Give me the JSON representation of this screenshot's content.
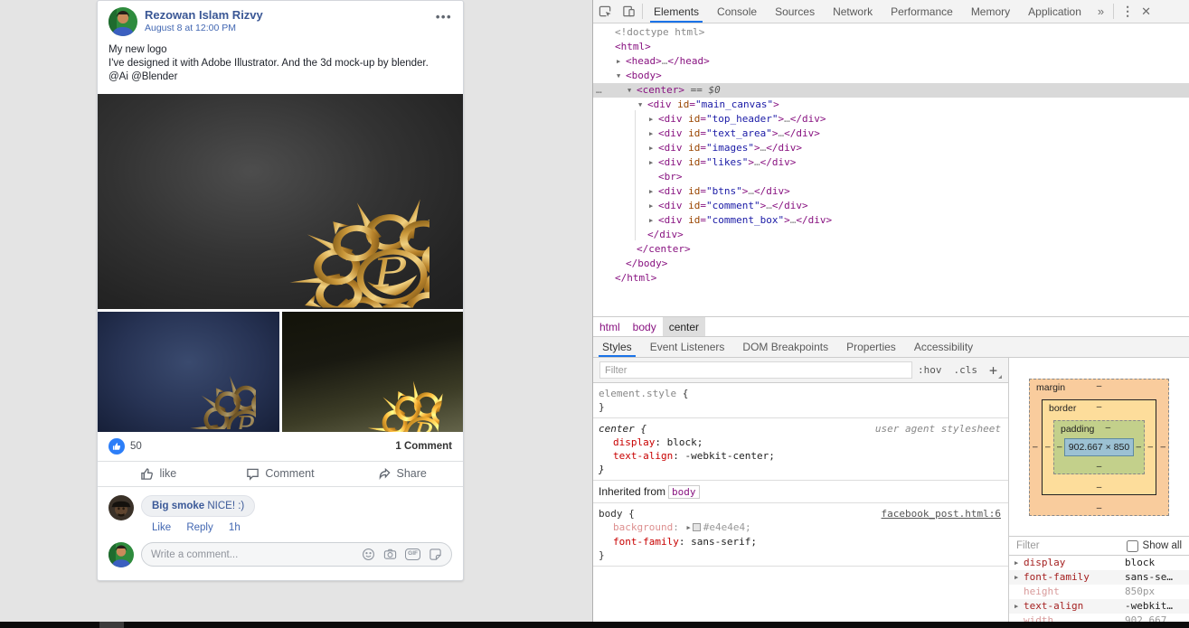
{
  "page": {
    "background": "#e4e4e4",
    "post": {
      "author": "Rezowan Islam Rizvy",
      "timestamp": "August 8 at 12:00 PM",
      "menu_dots": "•••",
      "text_lines": [
        "My new logo",
        "I've designed it with Adobe Illustrator. And the 3d mock-up by blender.",
        "@Ai @Blender"
      ],
      "like_count": "50",
      "comment_count": "1 Comment",
      "buttons": {
        "like": "like",
        "comment": "Comment",
        "share": "Share"
      },
      "comment": {
        "author": "Big smoke",
        "text": " NICE! :)",
        "actions": [
          "Like",
          "Reply",
          "1h"
        ]
      },
      "comment_input_placeholder": "Write a comment...",
      "gif_label": "GIF",
      "accent_blue": "#3b5998",
      "like_badge_color": "#2c7ef8"
    }
  },
  "devtools": {
    "tabs": [
      "Elements",
      "Console",
      "Sources",
      "Network",
      "Performance",
      "Memory",
      "Application"
    ],
    "active_tab": "Elements",
    "more_tabs_glyph": "»",
    "menu_glyph": "⋮",
    "close_glyph": "✕",
    "dom": {
      "lines": [
        {
          "ind": 0,
          "arw": "",
          "segs": [
            [
              "g",
              "<!doctype html>"
            ]
          ]
        },
        {
          "ind": 0,
          "arw": "",
          "segs": [
            [
              "t",
              "<html>"
            ]
          ]
        },
        {
          "ind": 1,
          "arw": "▶",
          "segs": [
            [
              "t",
              "<head>"
            ],
            [
              "g",
              "…"
            ],
            [
              "t",
              "</head>"
            ]
          ]
        },
        {
          "ind": 1,
          "arw": "▼",
          "segs": [
            [
              "t",
              "<body>"
            ]
          ]
        },
        {
          "ind": 2,
          "arw": "▼",
          "sel": true,
          "gut": "…",
          "segs": [
            [
              "t",
              "<center>"
            ],
            [
              "s",
              " == $0"
            ]
          ]
        },
        {
          "ind": 3,
          "arw": "▼",
          "segs": [
            [
              "t",
              "<div "
            ],
            [
              "n",
              "id"
            ],
            [
              "t",
              "="
            ],
            [
              "v",
              "\"main_canvas\""
            ],
            [
              "t",
              ">"
            ]
          ]
        },
        {
          "ind": 4,
          "arw": "▶",
          "segs": [
            [
              "t",
              "<div "
            ],
            [
              "n",
              "id"
            ],
            [
              "t",
              "="
            ],
            [
              "v",
              "\"top_header\""
            ],
            [
              "t",
              ">"
            ],
            [
              "g",
              "…"
            ],
            [
              "t",
              "</div>"
            ]
          ]
        },
        {
          "ind": 4,
          "arw": "▶",
          "segs": [
            [
              "t",
              "<div "
            ],
            [
              "n",
              "id"
            ],
            [
              "t",
              "="
            ],
            [
              "v",
              "\"text_area\""
            ],
            [
              "t",
              ">"
            ],
            [
              "g",
              "…"
            ],
            [
              "t",
              "</div>"
            ]
          ]
        },
        {
          "ind": 4,
          "arw": "▶",
          "segs": [
            [
              "t",
              "<div "
            ],
            [
              "n",
              "id"
            ],
            [
              "t",
              "="
            ],
            [
              "v",
              "\"images\""
            ],
            [
              "t",
              ">"
            ],
            [
              "g",
              "…"
            ],
            [
              "t",
              "</div>"
            ]
          ]
        },
        {
          "ind": 4,
          "arw": "▶",
          "segs": [
            [
              "t",
              "<div "
            ],
            [
              "n",
              "id"
            ],
            [
              "t",
              "="
            ],
            [
              "v",
              "\"likes\""
            ],
            [
              "t",
              ">"
            ],
            [
              "g",
              "…"
            ],
            [
              "t",
              "</div>"
            ]
          ]
        },
        {
          "ind": 4,
          "arw": "",
          "segs": [
            [
              "t",
              "<br>"
            ]
          ]
        },
        {
          "ind": 4,
          "arw": "▶",
          "segs": [
            [
              "t",
              "<div "
            ],
            [
              "n",
              "id"
            ],
            [
              "t",
              "="
            ],
            [
              "v",
              "\"btns\""
            ],
            [
              "t",
              ">"
            ],
            [
              "g",
              "…"
            ],
            [
              "t",
              "</div>"
            ]
          ]
        },
        {
          "ind": 4,
          "arw": "▶",
          "segs": [
            [
              "t",
              "<div "
            ],
            [
              "n",
              "id"
            ],
            [
              "t",
              "="
            ],
            [
              "v",
              "\"comment\""
            ],
            [
              "t",
              ">"
            ],
            [
              "g",
              "…"
            ],
            [
              "t",
              "</div>"
            ]
          ]
        },
        {
          "ind": 4,
          "arw": "▶",
          "segs": [
            [
              "t",
              "<div "
            ],
            [
              "n",
              "id"
            ],
            [
              "t",
              "="
            ],
            [
              "v",
              "\"comment_box\""
            ],
            [
              "t",
              ">"
            ],
            [
              "g",
              "…"
            ],
            [
              "t",
              "</div>"
            ]
          ]
        },
        {
          "ind": 3,
          "arw": "",
          "segs": [
            [
              "t",
              "</div>"
            ]
          ]
        },
        {
          "ind": 2,
          "arw": "",
          "segs": [
            [
              "t",
              "</center>"
            ]
          ]
        },
        {
          "ind": 1,
          "arw": "",
          "segs": [
            [
              "t",
              "</body>"
            ]
          ]
        },
        {
          "ind": 0,
          "arw": "",
          "segs": [
            [
              "t",
              "</html>"
            ]
          ]
        }
      ]
    },
    "breadcrumb": [
      {
        "label": "html",
        "selected": false
      },
      {
        "label": "body",
        "selected": false
      },
      {
        "label": "center",
        "selected": true
      }
    ],
    "panel_tabs": [
      "Styles",
      "Event Listeners",
      "DOM Breakpoints",
      "Properties",
      "Accessibility"
    ],
    "active_panel_tab": "Styles",
    "styles": {
      "filter_placeholder": "Filter",
      "pseudo_btn": ":hov",
      "class_btn": ".cls",
      "plus_btn": "+",
      "element_style": {
        "selector": "element.style",
        "open": "{",
        "close": "}"
      },
      "center_rule": {
        "selector": "center",
        "open": "{",
        "close": "}",
        "origin": "user agent stylesheet",
        "props": [
          {
            "name": "display",
            "value": "block"
          },
          {
            "name": "text-align",
            "value": "-webkit-center"
          }
        ]
      },
      "inherited_label": "Inherited from",
      "inherited_node": "body",
      "body_rule": {
        "selector": "body",
        "open": "{",
        "close": "}",
        "source": "facebook_post.html:6",
        "props": [
          {
            "name": "background",
            "value": "#e4e4e4",
            "grayed": true,
            "arrow": true,
            "swatch": true
          },
          {
            "name": "font-family",
            "value": "sans-serif"
          }
        ]
      }
    },
    "box_model": {
      "margin_label": "margin",
      "border_label": "border",
      "padding_label": "padding",
      "content": "902.667 × 850",
      "dash": "–"
    },
    "computed": {
      "filter_placeholder": "Filter",
      "show_all_label": "Show all",
      "rows": [
        {
          "name": "display",
          "value": "block",
          "arrow": true,
          "grayed": false
        },
        {
          "name": "font-family",
          "value": "sans-se…",
          "arrow": true,
          "grayed": false
        },
        {
          "name": "height",
          "value": "850px",
          "arrow": false,
          "grayed": true
        },
        {
          "name": "text-align",
          "value": "-webkit…",
          "arrow": true,
          "grayed": false
        },
        {
          "name": "width",
          "value": "902.667…",
          "arrow": false,
          "grayed": true
        }
      ]
    }
  }
}
